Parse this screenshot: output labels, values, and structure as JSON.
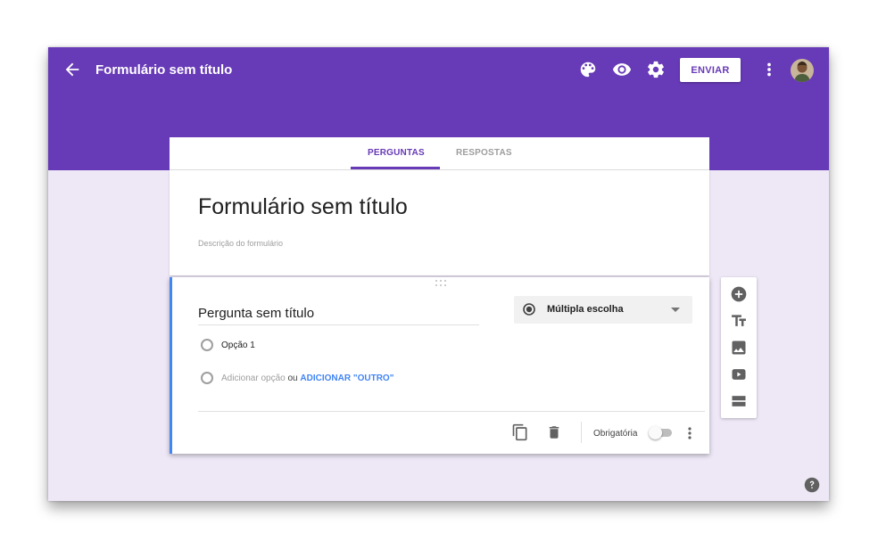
{
  "app": {
    "title": "Formulário sem título",
    "send_label": "ENVIAR",
    "accent_color": "#673ab7",
    "background_color": "#ede7f6",
    "icons": [
      "back-arrow-icon",
      "palette-icon",
      "eye-icon",
      "gear-icon",
      "more-vert-icon",
      "avatar"
    ]
  },
  "tabs": [
    {
      "label": "PERGUNTAS",
      "active": true
    },
    {
      "label": "RESPOSTAS",
      "active": false
    }
  ],
  "form": {
    "title": "Formulário sem título",
    "description_placeholder": "Descrição do formulário"
  },
  "question": {
    "title": "Pergunta sem título",
    "type": "Múltipla escolha",
    "options": [
      "Opção 1"
    ],
    "add_option": "Adicionar opção",
    "or": "ou",
    "add_other": "ADICIONAR \"OUTRO\"",
    "required_label": "Obrigatória",
    "required": false
  },
  "side_toolbar": {
    "icons": [
      "add-question-icon",
      "title-text-icon",
      "image-icon",
      "video-icon",
      "section-icon"
    ]
  },
  "help": {
    "icon": "help-icon"
  }
}
